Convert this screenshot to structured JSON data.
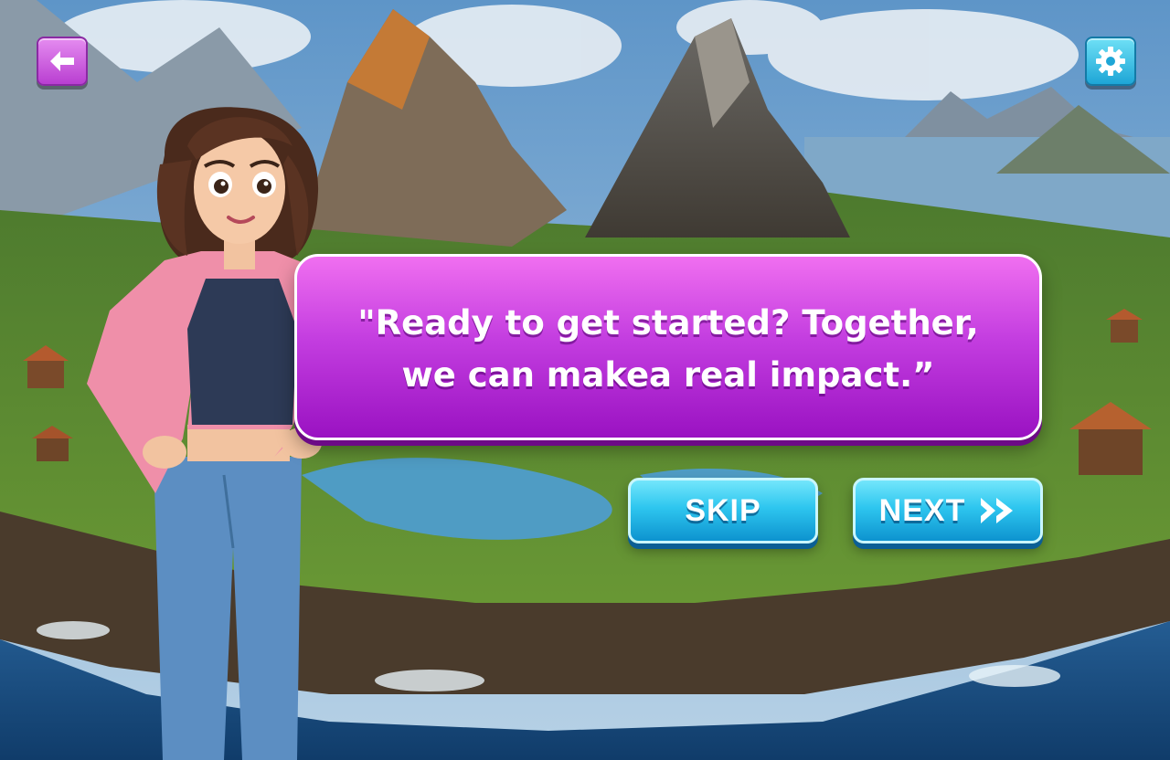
{
  "dialog": {
    "line1": "\"Ready to get started?  Together,",
    "line2": "we can makea real impact.”"
  },
  "buttons": {
    "skip_label": "SKIP",
    "next_label": "NEXT"
  },
  "icons": {
    "back": "arrow-left-icon",
    "settings": "gear-icon",
    "next": "double-chevron-right-icon"
  },
  "colors": {
    "bubble": "#c43ee0",
    "primary_button": "#2ec6ef",
    "back_button": "#c954dc",
    "settings_button": "#38b9e3"
  }
}
